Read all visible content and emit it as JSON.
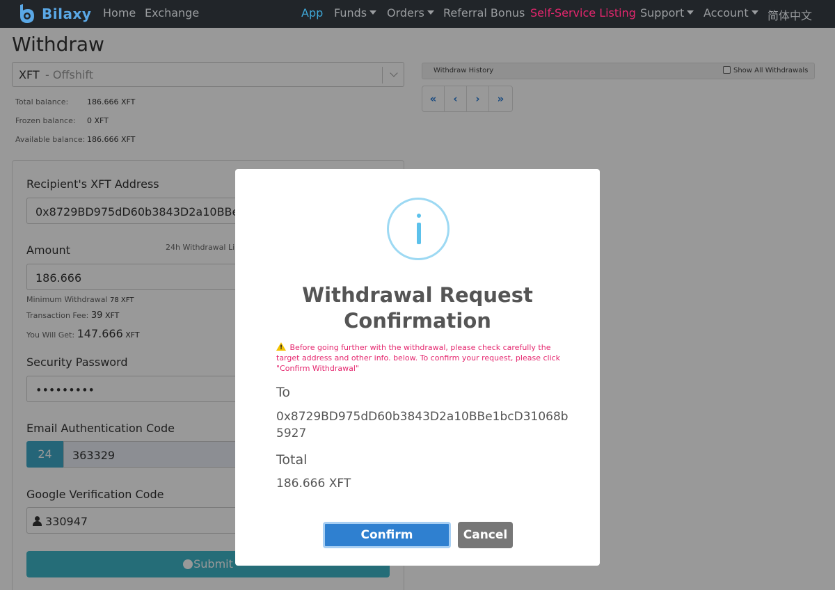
{
  "nav": {
    "brand": "Bilaxy",
    "items": [
      {
        "label": "Home"
      },
      {
        "label": "Exchange"
      },
      {
        "label": "App"
      },
      {
        "label": "Funds"
      },
      {
        "label": "Orders"
      },
      {
        "label": "Referral Bonus"
      },
      {
        "label": "Self-Service Listing"
      },
      {
        "label": "Support"
      },
      {
        "label": "Account"
      },
      {
        "label": "简体中文"
      }
    ],
    "colors": {
      "background": "#212529",
      "active": "#3fa8d8",
      "highlight": "#e5266e",
      "brand": "#5aa8e6"
    }
  },
  "page": {
    "title": "Withdraw",
    "coin": {
      "symbol": "XFT",
      "name": "- Offshift"
    },
    "balances": {
      "total_label": "Total balance:",
      "total_value": "186.666 XFT",
      "frozen_label": "Frozen balance:",
      "frozen_value": "0 XFT",
      "available_label": "Available balance:",
      "available_value": "186.666 XFT"
    }
  },
  "form": {
    "address_label": "Recipient's XFT Address",
    "address_value": "0x8729BD975dD60b3843D2a10BBe1",
    "amount_label": "Amount",
    "limit_label": "24h Withdrawal Lim",
    "amount_value": "186.666",
    "min_label": "Minimum Withdrawal",
    "min_value": "78 XFT",
    "fee_label": "Transaction Fee:",
    "fee_value": "39",
    "fee_unit": "XFT",
    "get_label": "You Will Get:",
    "get_value": "147.666",
    "get_unit": "XFT",
    "password_label": "Security Password",
    "password_value": "•••••••••",
    "email_label": "Email Authentication Code",
    "email_prefix": "24",
    "email_value": "363329",
    "google_label": "Google Verification Code",
    "google_value": "330947",
    "submit_label": "Submit"
  },
  "history": {
    "title": "Withdraw History",
    "show_all_label": "Show All Withdrawals",
    "show_all_checked": false,
    "pager": [
      "«",
      "‹",
      "›",
      "»"
    ]
  },
  "modal": {
    "icon": "info-icon",
    "title": "Withdrawal Request Confirmation",
    "warning_icon": "warning-icon",
    "warning": "Before going further with the withdrawal, please check carefully the target address and other info. below. To confirm your request, please click \"Confirm Withdrawal\"",
    "to_label": "To",
    "to_value": "0x8729BD975dD60b3843D2a10BBe1bcD31068b5927",
    "total_label": "Total",
    "total_value": "186.666 XFT",
    "confirm_label": "Confirm Withdrawal",
    "cancel_label": "Cancel",
    "colors": {
      "confirm": "#2f80d0",
      "cancel": "#777777",
      "warning_text": "#e5266e",
      "info_ring": "#9dd9f3"
    }
  }
}
